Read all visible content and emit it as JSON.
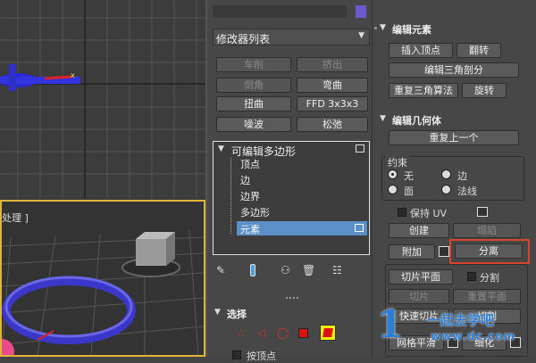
{
  "viewport": {
    "perspective_label": "处理 ]"
  },
  "modifier_panel": {
    "modifier_list": "修改器列表",
    "buttons": [
      {
        "label": "车削",
        "enabled": false
      },
      {
        "label": "挤出",
        "enabled": false
      },
      {
        "label": "倒角",
        "enabled": false
      },
      {
        "label": "弯曲",
        "enabled": true
      },
      {
        "label": "扭曲",
        "enabled": true
      },
      {
        "label": "FFD 3x3x3",
        "enabled": true
      },
      {
        "label": "噪波",
        "enabled": true
      },
      {
        "label": "松弛",
        "enabled": true
      }
    ],
    "stack_root": "可编辑多边形",
    "stack_items": [
      "顶点",
      "边",
      "边界",
      "多边形",
      "元素"
    ],
    "selected_item": "元素",
    "selection_title": "选择",
    "partial_label": "按顶点"
  },
  "edit_elements": {
    "title": "编辑元素",
    "insert_vertex": "插入顶点",
    "flip": "翻转",
    "edit_triangulation": "编辑三角剖分",
    "retriangulate": "重复三角算法",
    "turn": "旋转"
  },
  "edit_geometry": {
    "title": "编辑几何体",
    "repeat_last": "重复上一个",
    "constraints_label": "约束",
    "constraints": [
      {
        "label": "无",
        "selected": true
      },
      {
        "label": "边",
        "selected": false
      },
      {
        "label": "面",
        "selected": false
      },
      {
        "label": "法线",
        "selected": false
      }
    ],
    "preserve_uv": "保持 UV",
    "create": "创建",
    "collapse": "塌陷",
    "attach": "附加",
    "detach": "分离",
    "slice_plane": "切片平面",
    "split": "分割",
    "slice": "切片",
    "reset_plane": "重置平面",
    "quickslice": "快速切片",
    "cut": "切割",
    "meshsmooth": "网格平滑",
    "refine": "细化"
  },
  "watermark": {
    "logo": "1",
    "text": "一起去学吧",
    "url": "www.dc.com"
  },
  "colors": {
    "highlight_box": "#d9452b",
    "selected_stack": "#5b8fc7",
    "viewport_border": "#e0b43a"
  }
}
